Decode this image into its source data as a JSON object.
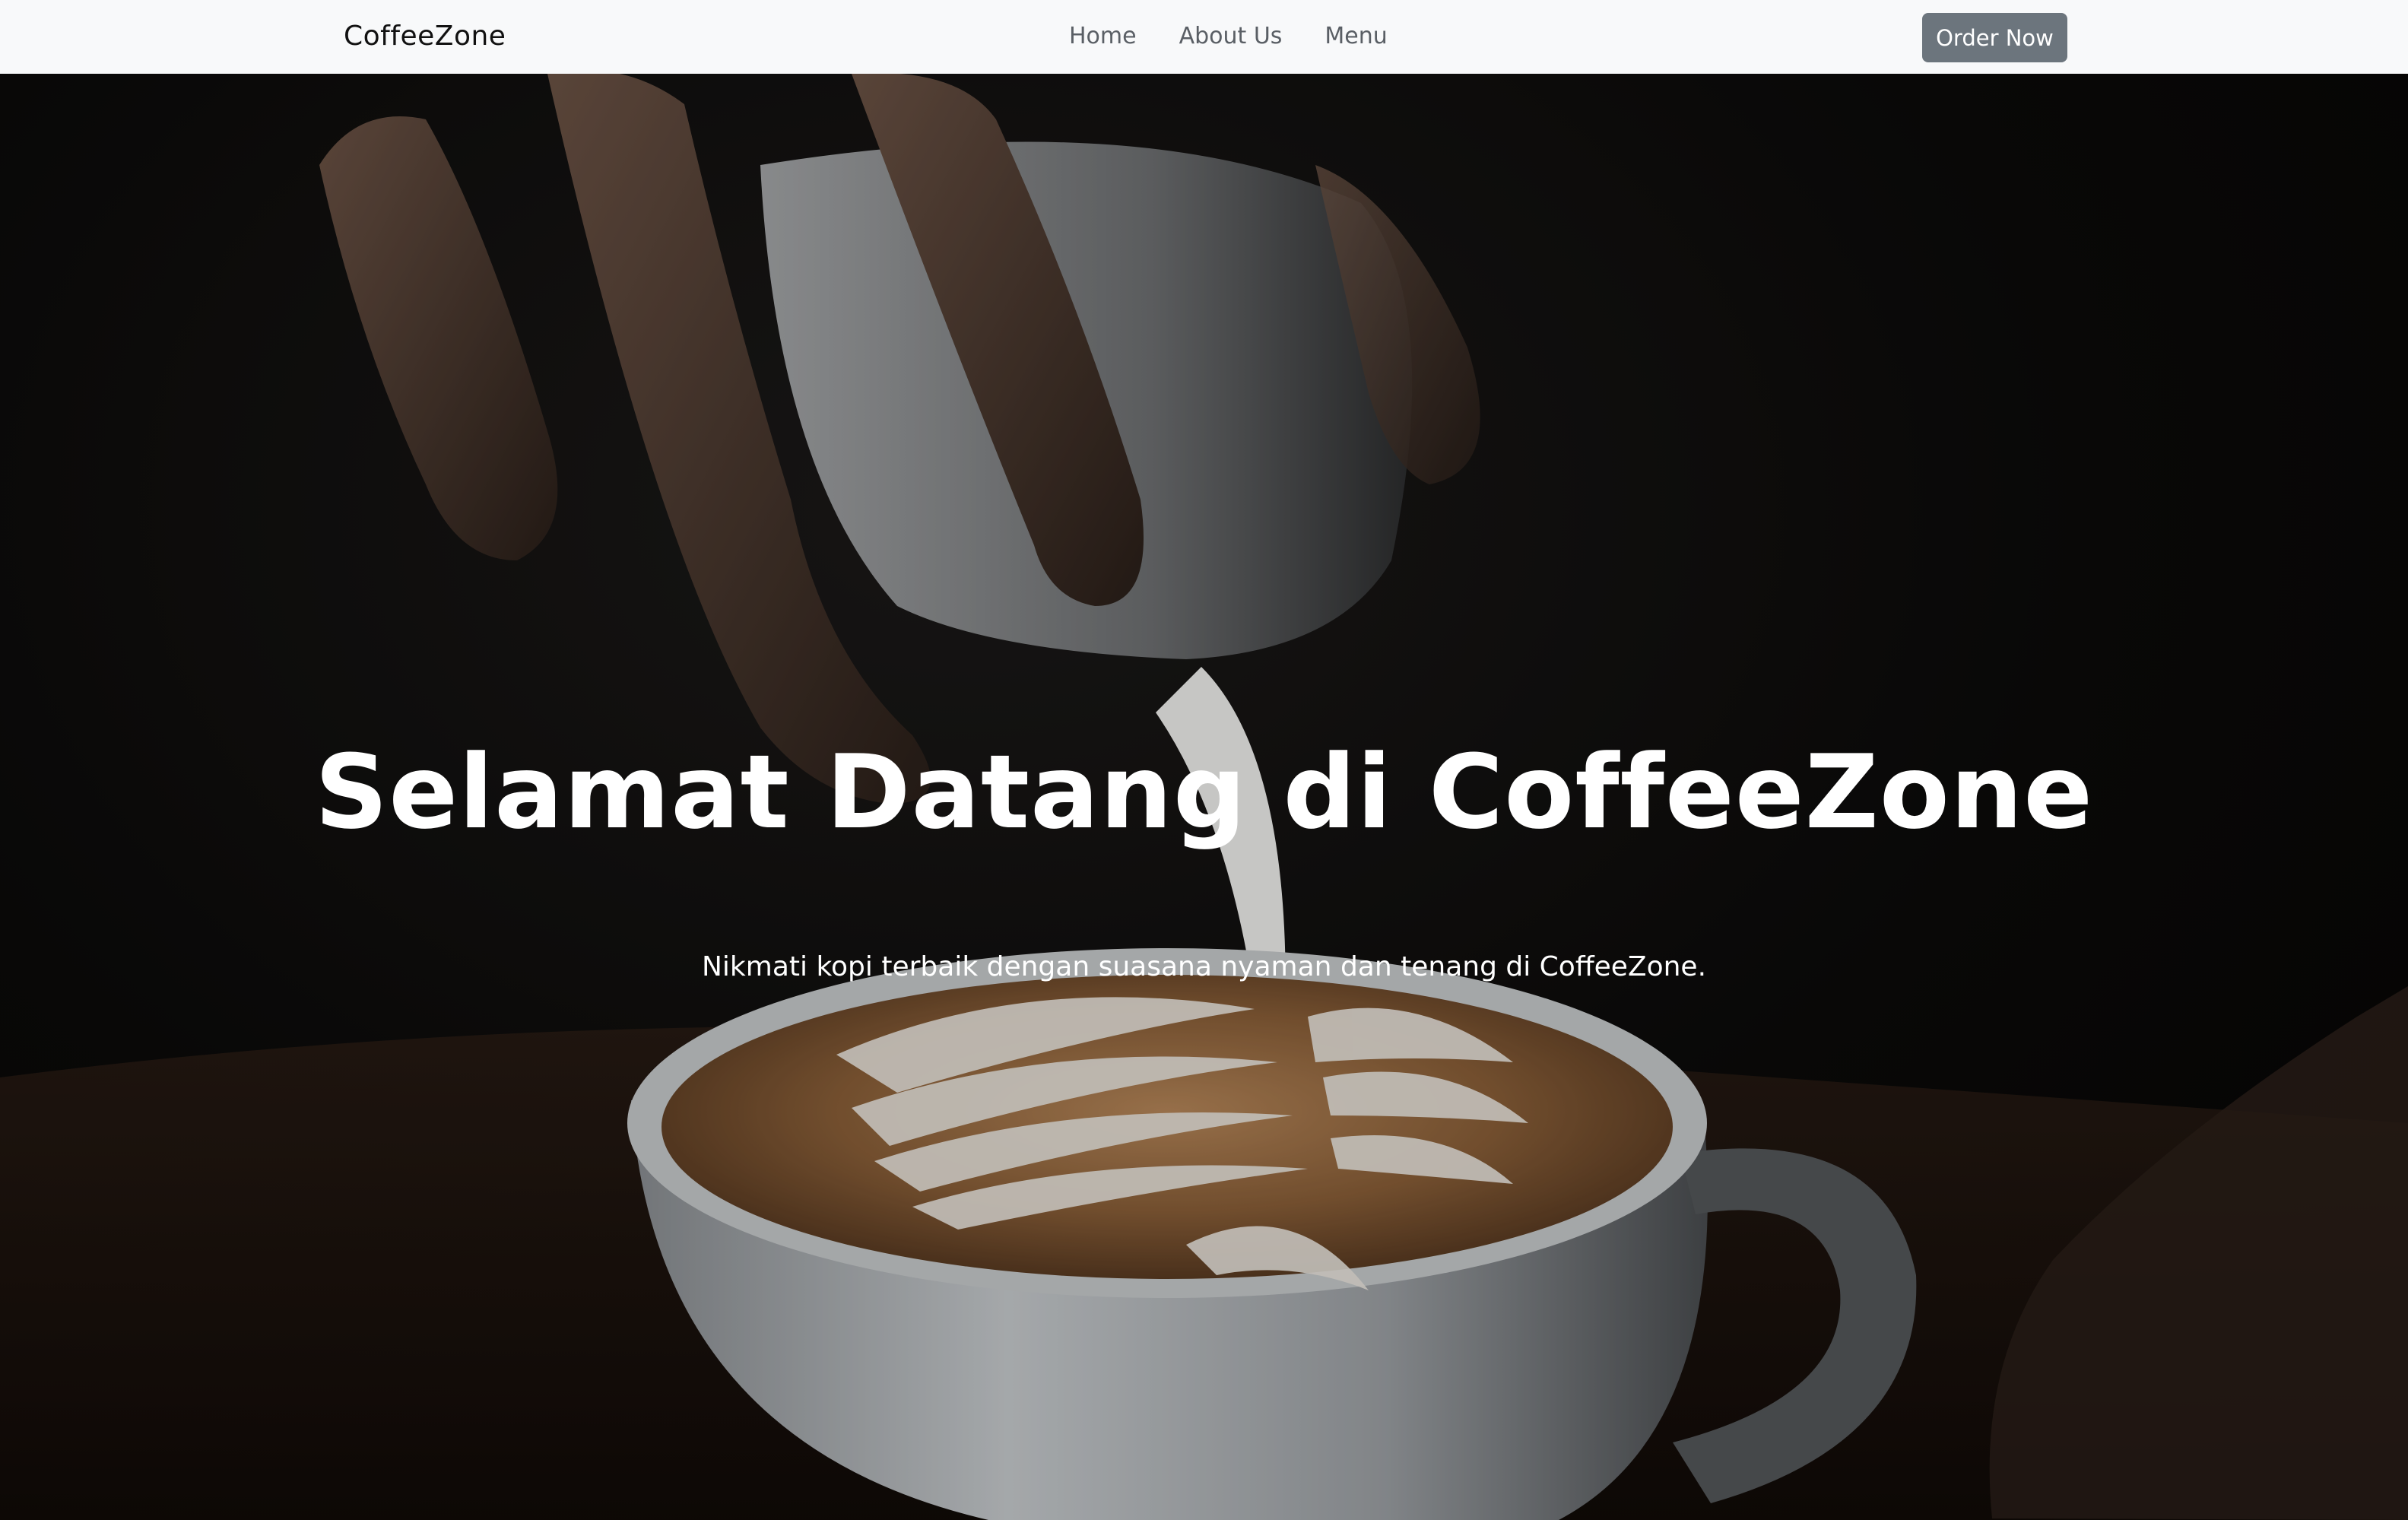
{
  "navbar": {
    "brand": "CoffeeZone",
    "links": [
      "Home",
      "About Us",
      "Menu"
    ],
    "order_button": "Order Now",
    "background": "#f8f9fa",
    "button_color": "#6c757d"
  },
  "hero": {
    "title": "Selamat Datang di CoffeeZone",
    "subtitle": "Nikmati kopi terbaik dengan suasana nyaman dan tenang di CoffeeZone.",
    "text_color": "#ffffff"
  }
}
